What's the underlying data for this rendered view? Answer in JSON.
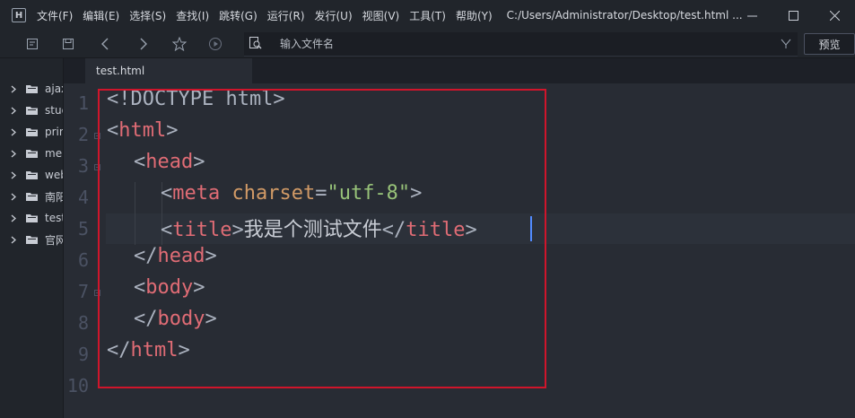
{
  "titlebar": {
    "menu": [
      "文件(F)",
      "编辑(E)",
      "选择(S)",
      "查找(I)",
      "跳转(G)",
      "运行(R)",
      "发行(U)",
      "视图(V)",
      "工具(T)",
      "帮助(Y)"
    ],
    "path": "C:/Users/Administrator/Desktop/test.html ...",
    "controls": [
      "minimize-icon",
      "maximize-icon",
      "close-icon"
    ]
  },
  "toolbar": {
    "icons": [
      "new-file-icon",
      "save-icon",
      "back-icon",
      "forward-icon",
      "star-icon",
      "run-icon"
    ],
    "filename_placeholder": "输入文件名",
    "filter_icon": "filter-icon",
    "preview_label": "预览"
  },
  "sidebar": {
    "items": [
      {
        "label": "ajax"
      },
      {
        "label": "stud"
      },
      {
        "label": "prin"
      },
      {
        "label": "me"
      },
      {
        "label": "web"
      },
      {
        "label": "南阳"
      },
      {
        "label": "test"
      },
      {
        "label": "官网"
      }
    ]
  },
  "tabs": [
    {
      "label": "test.html"
    }
  ],
  "editor": {
    "line_numbers": [
      "1",
      "2",
      "3",
      "4",
      "5",
      "6",
      "7",
      "8",
      "9",
      "10"
    ],
    "code": {
      "l1": "<!DOCTYPE html>",
      "l2_open": "<",
      "l2_tag": "html",
      "l2_close": ">",
      "l3_open": "<",
      "l3_tag": "head",
      "l3_close": ">",
      "l4_open": "<",
      "l4_tag": "meta",
      "l4_attr": "charset",
      "l4_eq": "=",
      "l4_val": "\"utf-8\"",
      "l4_close": ">",
      "l5_open": "<",
      "l5_tag": "title",
      "l5_close": ">",
      "l5_text": "我是个测试文件",
      "l5_end_open": "</",
      "l5_end_tag": "title",
      "l5_end_close": ">",
      "l6_open": "</",
      "l6_tag": "head",
      "l6_close": ">",
      "l7_open": "<",
      "l7_tag": "body",
      "l7_close": ">",
      "l8_open": "</",
      "l8_tag": "body",
      "l8_close": ">",
      "l9_open": "</",
      "l9_tag": "html",
      "l9_close": ">"
    },
    "colors": {
      "tag": "#e06c75",
      "attr": "#d19a66",
      "string": "#98c379",
      "highlight_box": "#d0152b"
    }
  }
}
